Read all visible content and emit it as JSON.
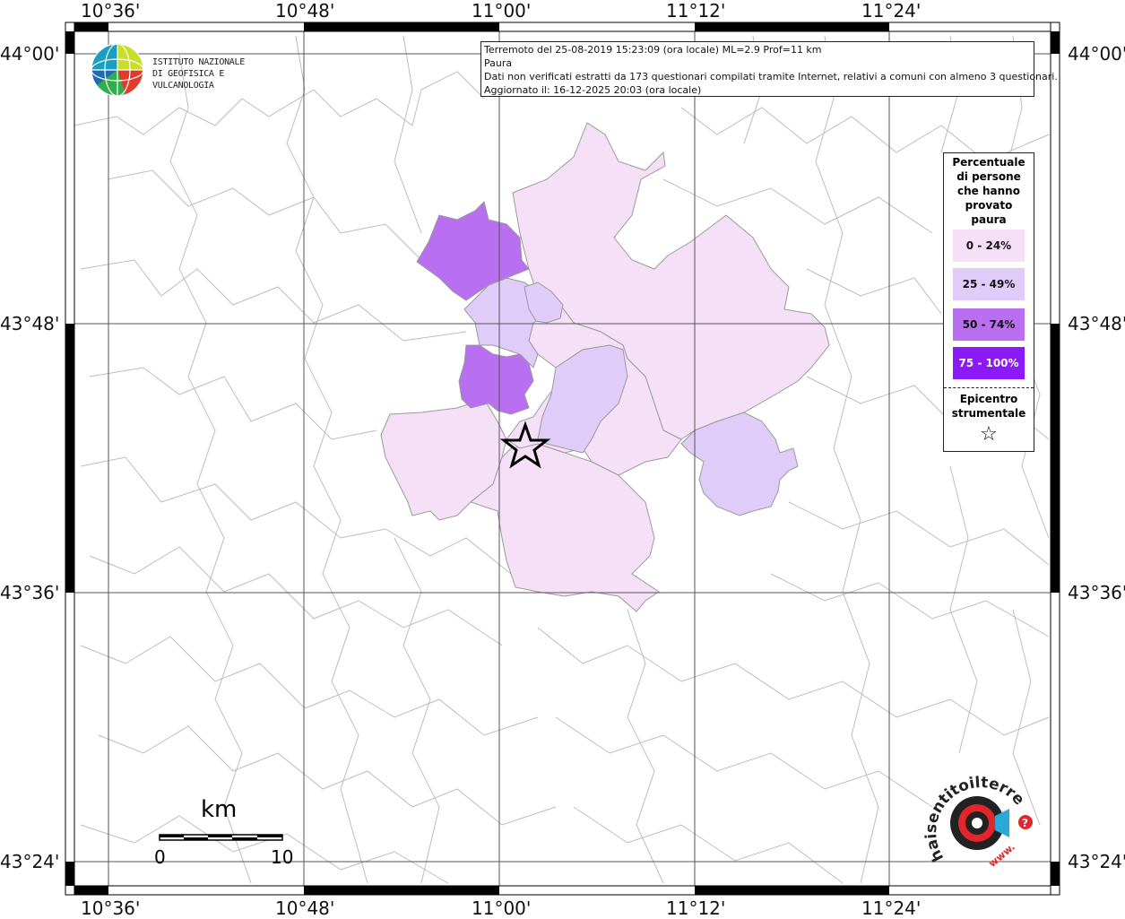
{
  "map": {
    "top_labels": [
      "10°36'",
      "10°48'",
      "11°00'",
      "11°12'",
      "11°24'"
    ],
    "bottom_labels": [
      "10°36'",
      "10°48'",
      "11°00'",
      "11°12'",
      "11°24'"
    ],
    "left_labels": [
      "44°00'",
      "43°48'",
      "43°36'",
      "43°24'"
    ],
    "right_labels": [
      "44°00'",
      "43°48'",
      "43°36'",
      "43°24'"
    ]
  },
  "info": {
    "line1": "Terremoto del 25-08-2019 15:23:09 (ora locale) ML=2.9 Prof=11 km",
    "line2": "Paura",
    "line3": "Dati non verificati estratti da 173 questionari compilati tramite Internet, relativi a comuni con almeno 3 questionari.",
    "line4": "Aggiornato il: 16-12-2025 20:03 (ora locale)"
  },
  "logo": {
    "line1": "ISTITUTO NAZIONALE",
    "line2": "DI GEOFISICA E VULCANOLOGIA"
  },
  "legend": {
    "title": [
      "Percentuale",
      "di persone",
      "che hanno",
      "provato",
      "paura"
    ],
    "classes": [
      {
        "label": "0 - 24%",
        "color": "#f5e0f8"
      },
      {
        "label": "25 - 49%",
        "color": "#e0ccf8"
      },
      {
        "label": "50 - 74%",
        "color": "#b870f0"
      },
      {
        "label": "75 - 100%",
        "color": "#8a1af8"
      }
    ],
    "epicentre": [
      "Epicentro",
      "strumentale"
    ],
    "epicentre_symbol": "☆"
  },
  "scale": {
    "unit": "km",
    "start": "0",
    "end": "10"
  },
  "hsi_logo": {
    "text": "haisentitoilterremoto.it",
    "url_text": "www."
  }
}
